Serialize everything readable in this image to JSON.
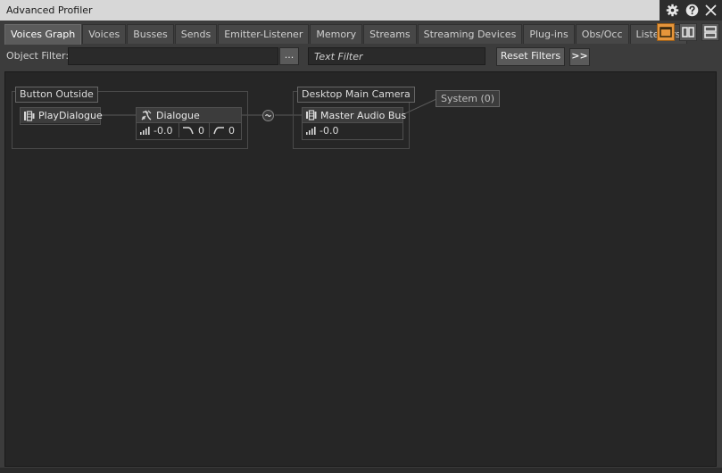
{
  "window": {
    "title": "Advanced Profiler"
  },
  "title_icons": [
    "gear-icon",
    "help-icon",
    "close-icon"
  ],
  "tabs": [
    {
      "label": "Voices Graph",
      "active": true
    },
    {
      "label": "Voices"
    },
    {
      "label": "Busses"
    },
    {
      "label": "Sends"
    },
    {
      "label": "Emitter-Listener"
    },
    {
      "label": "Memory"
    },
    {
      "label": "Streams"
    },
    {
      "label": "Streaming Devices"
    },
    {
      "label": "Plug-ins"
    },
    {
      "label": "Obs/Occ"
    },
    {
      "label": "Listeners"
    }
  ],
  "view_buttons": [
    "single-view-icon",
    "split-view-icon",
    "stacked-view-icon"
  ],
  "filter": {
    "object_label": "Object Filter:",
    "object_value": "",
    "browse_label": "...",
    "text_placeholder": "Text Filter",
    "reset_label": "Reset Filters",
    "more_label": ">>"
  },
  "graph": {
    "groups": {
      "emitter": "Button Outside",
      "listener": "Desktop Main Camera"
    },
    "nodes": {
      "play_dialogue": {
        "name": "PlayDialogue"
      },
      "dialogue": {
        "name": "Dialogue",
        "volume": "-0.0",
        "lowpass": "0",
        "highpass": "0"
      },
      "master_bus": {
        "name": "Master Audio Bus",
        "volume": "-0.0"
      }
    },
    "output": "System (0)"
  },
  "colors": {
    "accent": "#e6953b",
    "title_bar": "#d7d7d7",
    "canvas": "#262626"
  }
}
